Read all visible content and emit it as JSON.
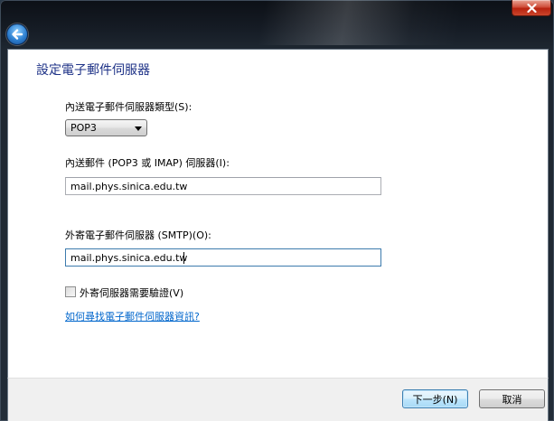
{
  "window": {
    "close_icon": "close-icon",
    "back_icon": "back-arrow-icon",
    "accent": "#1e3287"
  },
  "page": {
    "title": "設定電子郵件伺服器"
  },
  "incoming_type": {
    "label": "內送電子郵件伺服器類型(S):",
    "selected": "POP3",
    "icon": "chevron-down-icon"
  },
  "incoming_server": {
    "label": "內送郵件 (POP3 或 IMAP) 伺服器(I):",
    "value": "mail.phys.sinica.edu.tw"
  },
  "outgoing_server": {
    "label": "外寄電子郵件伺服器 (SMTP)(O):",
    "value": "mail.phys.sinica.edu.tw"
  },
  "auth_checkbox": {
    "label": "外寄伺服器需要驗證(V)",
    "checked": false
  },
  "help": {
    "link_text": "如何尋找電子郵件伺服器資訊?"
  },
  "footer": {
    "next_label": "下一步(N)",
    "cancel_label": "取消"
  }
}
